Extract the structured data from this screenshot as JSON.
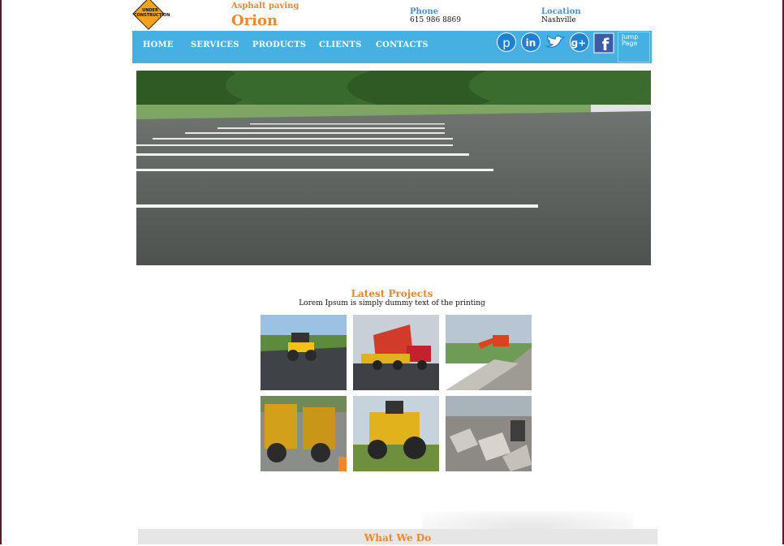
{
  "header": {
    "logo_text": "UNDER CONSTRUCTION",
    "brand_sub": "Asphalt paving",
    "brand_name": "Orion",
    "phone_label": "Phone",
    "phone_value": "615 986 8869",
    "location_label": "Location",
    "location_value": "Nashville"
  },
  "nav": {
    "items": [
      "HOME",
      "SERVICES",
      "PRODUCTS",
      "CLIENTS",
      "CONTACTS"
    ],
    "social": [
      "pinterest-icon",
      "linkedin-icon",
      "twitter-icon",
      "google-plus-icon",
      "facebook-icon"
    ],
    "jump_text": "Jump Page"
  },
  "projects": {
    "title": "Latest Projects",
    "subtitle": "Lorem Ipsum is simply dummy text of the printing"
  },
  "what_we_do": {
    "title": "What We Do"
  },
  "colors": {
    "accent": "#f0872c",
    "nav": "#45b0e1",
    "label": "#4a8fd6"
  }
}
